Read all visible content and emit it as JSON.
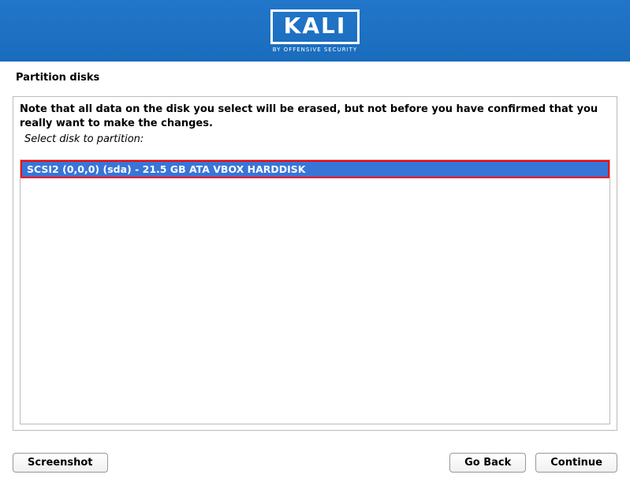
{
  "header": {
    "brand": "KALI",
    "tagline": "BY OFFENSIVE SECURITY"
  },
  "page": {
    "title": "Partition disks",
    "warning": "Note that all data on the disk you select will be erased, but not before you have confirmed that you really want to make the changes.",
    "prompt": "Select disk to partition:"
  },
  "disks": [
    {
      "label": "SCSI2 (0,0,0) (sda) - 21.5 GB ATA VBOX HARDDISK"
    }
  ],
  "buttons": {
    "screenshot": "Screenshot",
    "go_back": "Go Back",
    "continue": "Continue"
  }
}
